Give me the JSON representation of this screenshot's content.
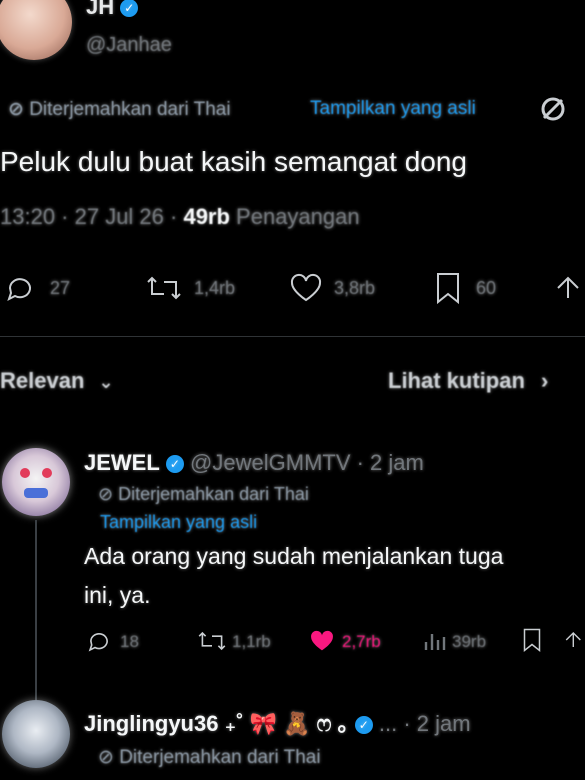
{
  "author": {
    "display_name": "JH",
    "handle": "@Janhae"
  },
  "translation": {
    "translated_from": "Diterjemahkan dari Thai",
    "show_original": "Tampilkan yang asli"
  },
  "tweet": {
    "text": "Peluk dulu buat kasih semangat dong",
    "time": "13:20 · 27 Jul 26 · ",
    "views_count": "49rb",
    "views_label": " Penayangan",
    "replies": "27",
    "retweets": "1,4rb",
    "likes": "3,8rb",
    "bookmarks": "60"
  },
  "reply_bar": {
    "sort_label": "Relevan",
    "quotes_label": "Lihat kutipan"
  },
  "replies": [
    {
      "display_name": "JEWEL",
      "handle": "@JewelGMMTV · 2 jam",
      "translated_from": "Diterjemahkan dari Thai",
      "show_original": "Tampilkan yang asli",
      "text_line1": "Ada orang yang sudah menjalankan tuga",
      "text_line2": "ini, ya.",
      "replies": "18",
      "retweets": "1,1rb",
      "likes": "2,7rb",
      "views": "39rb"
    },
    {
      "display_name": "Jinglingyu36 ₊˚ 🎀 🧸 ෆ ｡",
      "handle": "... · 2 jam",
      "translated_from": "Diterjemahkan dari Thai"
    }
  ],
  "colors": {
    "background": "#000000",
    "accent": "#1d9bf0",
    "like_active": "#f91880",
    "muted": "#71767b"
  }
}
